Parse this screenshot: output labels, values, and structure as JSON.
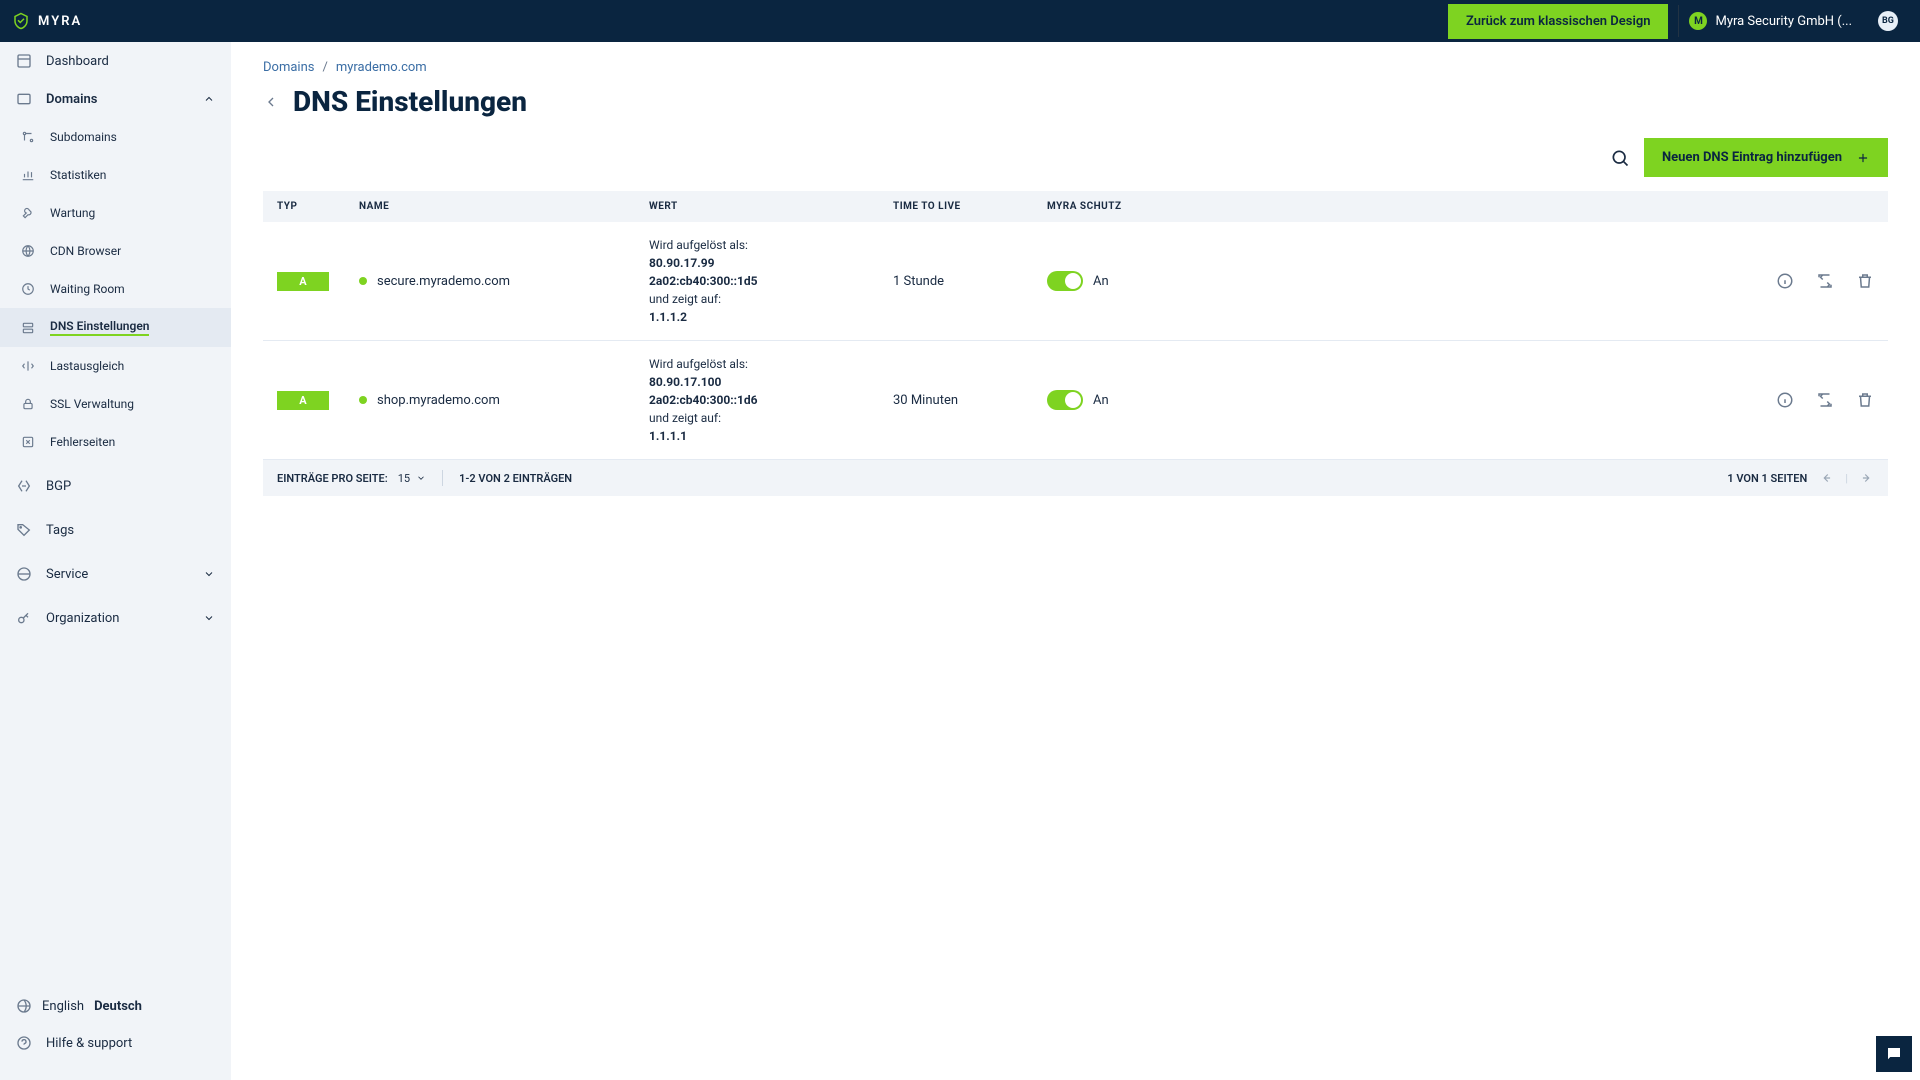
{
  "header": {
    "brand": "MYRA",
    "classic_button": "Zurück zum klassischen Design",
    "org_initial": "M",
    "org_name": "Myra Security GmbH (...",
    "user_initial": "BG"
  },
  "sidebar": {
    "dashboard": "Dashboard",
    "domains": "Domains",
    "sub": {
      "subdomains": "Subdomains",
      "stats": "Statistiken",
      "maintenance": "Wartung",
      "cdn": "CDN Browser",
      "waiting": "Waiting Room",
      "dns": "DNS Einstellungen",
      "lb": "Lastausgleich",
      "ssl": "SSL Verwaltung",
      "errors": "Fehlerseiten"
    },
    "bgp": "BGP",
    "tags": "Tags",
    "service": "Service",
    "organization": "Organization",
    "lang_en": "English",
    "lang_de": "Deutsch",
    "help": "Hilfe & support"
  },
  "breadcrumb": {
    "domains": "Domains",
    "current": "myrademo.com"
  },
  "page": {
    "title": "DNS Einstellungen",
    "add_button": "Neuen DNS Eintrag hinzufügen"
  },
  "table": {
    "headers": {
      "typ": "TYP",
      "name": "NAME",
      "wert": "WERT",
      "ttl": "TIME TO LIVE",
      "schutz": "MYRA SCHUTZ"
    },
    "wert_resolve_label": "Wird aufgelöst als:",
    "wert_points_label": "und zeigt auf:",
    "schutz_on": "An",
    "rows": [
      {
        "type": "A",
        "name": "secure.myrademo.com",
        "resolve1": "80.90.17.99",
        "resolve2": "2a02:cb40:300::1d5",
        "points": "1.1.1.2",
        "ttl": "1 Stunde"
      },
      {
        "type": "A",
        "name": "shop.myrademo.com",
        "resolve1": "80.90.17.100",
        "resolve2": "2a02:cb40:300::1d6",
        "points": "1.1.1.1",
        "ttl": "30 Minuten"
      }
    ]
  },
  "pager": {
    "per_page_label": "EINTRÄGE PRO SEITE:",
    "per_page_value": "15",
    "range": "1-2 VON 2 EINTRÄGEN",
    "pages": "1 VON 1 SEITEN"
  }
}
